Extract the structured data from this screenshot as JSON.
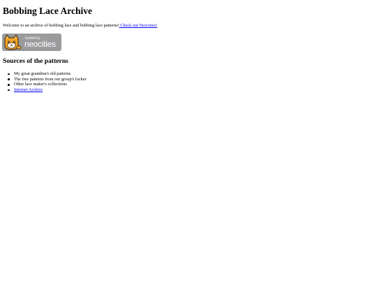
{
  "header": {
    "title": "Bobbing Lace Archive"
  },
  "intro": {
    "text": "Welcome to an archive of bobbing lace and bobbing lace patterns!",
    "link_label": " Check out Neocities!"
  },
  "badge": {
    "line_small": "hosted by",
    "line_big": "neocities",
    "icon": "neocities-cat-icon",
    "colors": {
      "background": "#9a9b9d",
      "cat": "#f6a623",
      "cat_outline": "#4a3320"
    }
  },
  "sources": {
    "heading": "Sources of the patterns",
    "items": [
      {
        "label": "My great grandma's old patterns",
        "is_link": false
      },
      {
        "label": "The free patterns from our group's locker",
        "is_link": false
      },
      {
        "label": "Other lace maker's collections",
        "is_link": false
      },
      {
        "label": "Internet Archive",
        "is_link": true
      }
    ]
  },
  "colors": {
    "link": "#0000ee",
    "text": "#000000",
    "background": "#ffffff"
  }
}
